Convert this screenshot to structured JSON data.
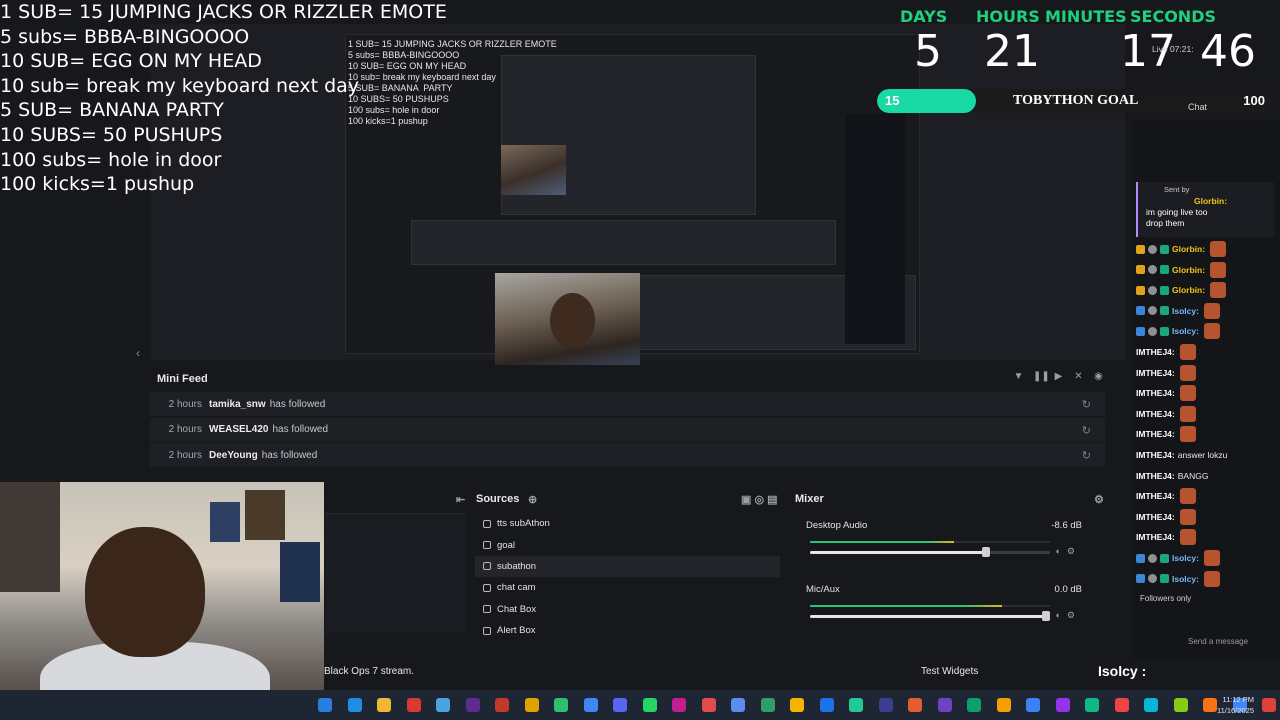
{
  "overlay_rules": [
    "1 SUB= 15 JUMPING JACKS OR RIZZLER EMOTE",
    "5 subs= BBBA-BINGOOOO",
    "10 SUB= EGG ON MY HEAD",
    "10 sub= break my keyboard next day",
    "5 SUB= BANANA  PARTY",
    "10 SUBS= 50 PUSHUPS",
    "100 subs= hole in door",
    "100 kicks=1 pushup"
  ],
  "countdown": {
    "labels": [
      "DAYS",
      "HOURS",
      "MINUTES",
      "SECONDS"
    ],
    "values": [
      "5",
      "21",
      "17",
      "46"
    ],
    "accent": "#1fd07c"
  },
  "goal": {
    "current": "15",
    "title": "TOBYTHON GOAL",
    "target": "100",
    "progress": 0.15,
    "color": "#19d9a5"
  },
  "live_text": "Live 07:21:",
  "mini_feed": {
    "title": "Mini Feed",
    "rows": [
      {
        "time": "2 hours",
        "user": "tamika_snw",
        "action": "has followed"
      },
      {
        "time": "2 hours",
        "user": "WEASEL420",
        "action": "has followed"
      },
      {
        "time": "2 hours",
        "user": "DeeYoung",
        "action": "has followed"
      }
    ]
  },
  "sources": {
    "title": "Sources",
    "items": [
      "tts subAthon",
      "goal",
      "subathon",
      "chat cam",
      "Chat Box",
      "Alert Box"
    ]
  },
  "mixer": {
    "title": "Mixer",
    "channels": [
      {
        "name": "Desktop Audio",
        "db": "-8.6 dB",
        "level": 0.75
      },
      {
        "name": "Mic/Aux",
        "db": "0.0 dB",
        "level": 1.0
      }
    ]
  },
  "chat": {
    "title": "Chat",
    "sent_by": "Sent by",
    "pinned_user": "Glorbin:",
    "pinned_message": "im going live too drop them",
    "lines": [
      {
        "user": "Glorbin:",
        "msg": "",
        "color": "#f0c419"
      },
      {
        "user": "Glorbin:",
        "msg": "",
        "color": "#f0c419"
      },
      {
        "user": "Glorbin:",
        "msg": "",
        "color": "#f0c419"
      },
      {
        "user": "Isolcy:",
        "msg": "",
        "color": "#7ab8ff"
      },
      {
        "user": "Isolcy:",
        "msg": "",
        "color": "#7ab8ff"
      },
      {
        "user": "IMTHEJ4:",
        "msg": "",
        "color": "#ffffff"
      },
      {
        "user": "IMTHEJ4:",
        "msg": "",
        "color": "#ffffff"
      },
      {
        "user": "IMTHEJ4:",
        "msg": "",
        "color": "#ffffff"
      },
      {
        "user": "IMTHEJ4:",
        "msg": "",
        "color": "#ffffff"
      },
      {
        "user": "IMTHEJ4:",
        "msg": "",
        "color": "#ffffff"
      },
      {
        "user": "IMTHEJ4:",
        "msg": "answer lokzu",
        "color": "#ffffff"
      },
      {
        "user": "IMTHEJ4:",
        "msg": "BANGG",
        "color": "#ffffff"
      },
      {
        "user": "IMTHEJ4:",
        "msg": "",
        "color": "#ffffff"
      },
      {
        "user": "IMTHEJ4:",
        "msg": "",
        "color": "#ffffff"
      },
      {
        "user": "IMTHEJ4:",
        "msg": "",
        "color": "#ffffff"
      },
      {
        "user": "Isolcy:",
        "msg": "",
        "color": "#7ab8ff"
      },
      {
        "user": "Isolcy:",
        "msg": "",
        "color": "#7ab8ff"
      }
    ],
    "followers_only": "Followers only",
    "send_placeholder": "Send a message"
  },
  "status": {
    "stream_text": "Black Ops 7 stream.",
    "test_widgets": "Test Widgets",
    "isolcy": "Isolcy :"
  },
  "taskbar": {
    "time": "11:12 PM",
    "date": "11/16/2025"
  }
}
